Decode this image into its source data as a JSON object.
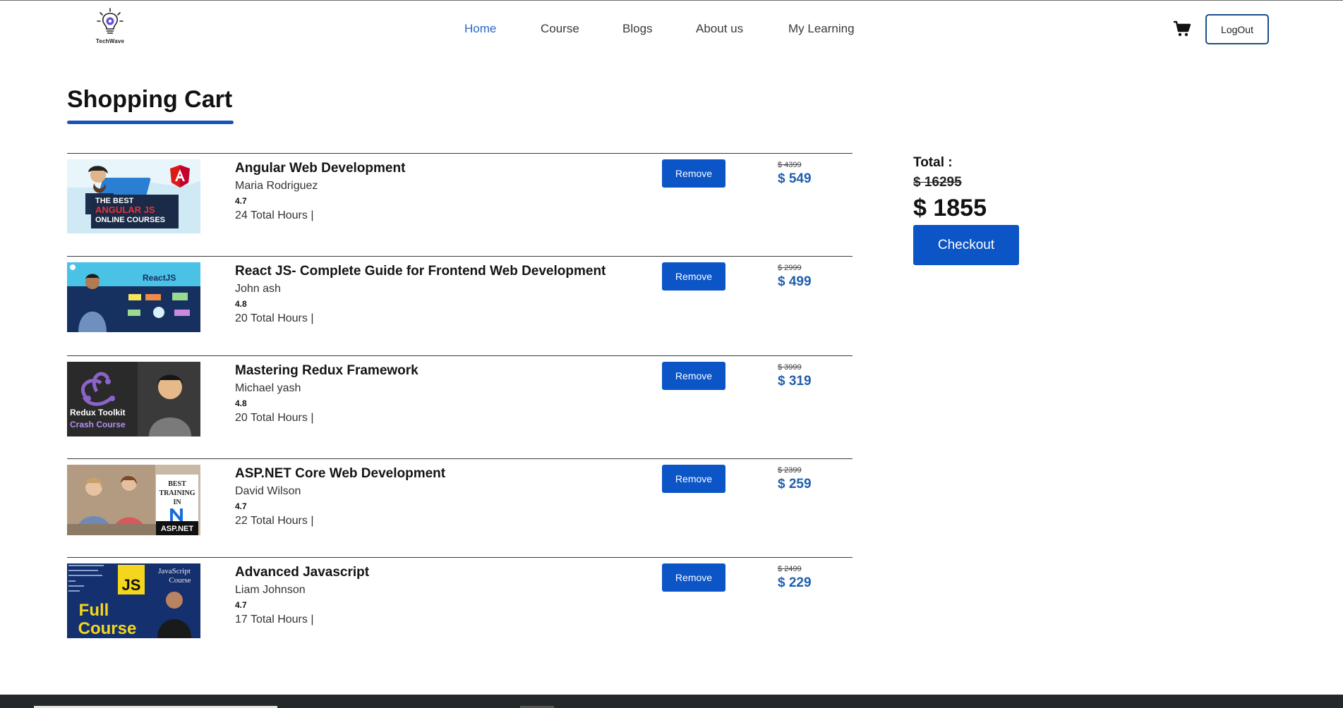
{
  "brand": {
    "name": "TechWave"
  },
  "nav": {
    "items": [
      {
        "label": "Home",
        "active": true
      },
      {
        "label": "Course",
        "active": false
      },
      {
        "label": "Blogs",
        "active": false
      },
      {
        "label": "About us",
        "active": false
      },
      {
        "label": "My Learning",
        "active": false
      }
    ]
  },
  "header": {
    "cart_icon": "shopping-cart-icon",
    "logout_label": "LogOut"
  },
  "page": {
    "title": "Shopping Cart"
  },
  "cart": {
    "remove_label": "Remove",
    "items": [
      {
        "title": "Angular Web Development",
        "author": "Maria Rodriguez",
        "rating": "4.7",
        "hours": "24 Total Hours |",
        "original_price": "$ 4399",
        "price": "$ 549",
        "thumb_text": [
          "THE BEST",
          "ANGULAR JS",
          "ONLINE COURSES"
        ]
      },
      {
        "title": "React JS- Complete Guide for Frontend Web Development",
        "author": "John ash",
        "rating": "4.8",
        "hours": "20 Total Hours |",
        "original_price": "$ 2999",
        "price": "$ 499",
        "thumb_text": [
          "ReactJS"
        ]
      },
      {
        "title": "Mastering Redux Framework",
        "author": "Michael yash",
        "rating": "4.8",
        "hours": "20 Total Hours |",
        "original_price": "$ 3999",
        "price": "$ 319",
        "thumb_text": [
          "Redux Toolkit",
          "Crash Course"
        ]
      },
      {
        "title": "ASP.NET Core Web Development",
        "author": "David Wilson",
        "rating": "4.7",
        "hours": "22 Total Hours |",
        "original_price": "$ 2399",
        "price": "$ 259",
        "thumb_text": [
          "BEST",
          "TRAINING",
          "IN",
          "ASP.NET"
        ]
      },
      {
        "title": "Advanced Javascript",
        "author": "Liam Johnson",
        "rating": "4.7",
        "hours": "17 Total Hours |",
        "original_price": "$ 2499",
        "price": "$ 229",
        "thumb_text": [
          "JavaScript",
          "Course",
          "JS",
          "Full",
          "Course"
        ]
      }
    ]
  },
  "summary": {
    "total_label": "Total :",
    "original_total": "$ 16295",
    "final_total": "$ 1855",
    "checkout_label": "Checkout"
  },
  "colors": {
    "accent": "#0b55c7",
    "price": "#1f5fae",
    "nav_active": "#2a66c4",
    "footer": "#23282b"
  }
}
